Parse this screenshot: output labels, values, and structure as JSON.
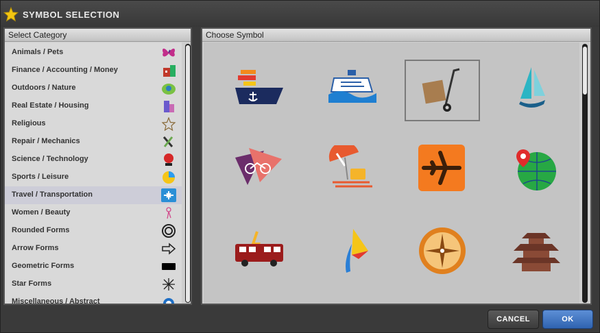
{
  "dialog": {
    "title": "SYMBOL SELECTION"
  },
  "left_panel": {
    "header": "Select Category",
    "categories": [
      {
        "label": "Animals / Pets",
        "icon": "butterfly-icon"
      },
      {
        "label": "Finance / Accounting / Money",
        "icon": "bank-icon"
      },
      {
        "label": "Outdoors / Nature",
        "icon": "nature-icon"
      },
      {
        "label": "Real Estate / Housing",
        "icon": "buildings-icon"
      },
      {
        "label": "Religious",
        "icon": "star-outline-icon"
      },
      {
        "label": "Repair / Mechanics",
        "icon": "tools-icon"
      },
      {
        "label": "Science / Technology",
        "icon": "satellite-dish-icon"
      },
      {
        "label": "Sports / Leisure",
        "icon": "sports-icon"
      },
      {
        "label": "Travel / Transportation",
        "icon": "airplane-icon",
        "selected": true
      },
      {
        "label": "Women / Beauty",
        "icon": "woman-icon"
      },
      {
        "label": "Rounded Forms",
        "icon": "round-form-icon"
      },
      {
        "label": "Arrow Forms",
        "icon": "arrow-icon"
      },
      {
        "label": "Geometric Forms",
        "icon": "rectangle-icon"
      },
      {
        "label": "Star Forms",
        "icon": "starburst-icon"
      },
      {
        "label": "Miscellaneous / Abstract",
        "icon": "abstract-icon"
      }
    ]
  },
  "right_panel": {
    "header": "Choose Symbol",
    "symbols": [
      {
        "icon": "cargo-ship-icon",
        "selected": false
      },
      {
        "icon": "cruise-ship-icon",
        "selected": false
      },
      {
        "icon": "hand-truck-icon",
        "selected": true
      },
      {
        "icon": "sailboat-icon",
        "selected": false
      },
      {
        "icon": "bicycle-triangles-icon",
        "selected": false
      },
      {
        "icon": "beach-umbrella-icon",
        "selected": false
      },
      {
        "icon": "airplane-tile-icon",
        "selected": false
      },
      {
        "icon": "globe-pin-icon",
        "selected": false
      },
      {
        "icon": "bus-icon",
        "selected": false
      },
      {
        "icon": "windsurf-icon",
        "selected": false
      },
      {
        "icon": "compass-icon",
        "selected": false
      },
      {
        "icon": "pagoda-icon",
        "selected": false
      }
    ]
  },
  "buttons": {
    "cancel": "CANCEL",
    "ok": "OK"
  },
  "colors": {
    "accent": "#2f63b0",
    "title_star": "#f2c511",
    "airplane_tile": "#f47a1f"
  }
}
